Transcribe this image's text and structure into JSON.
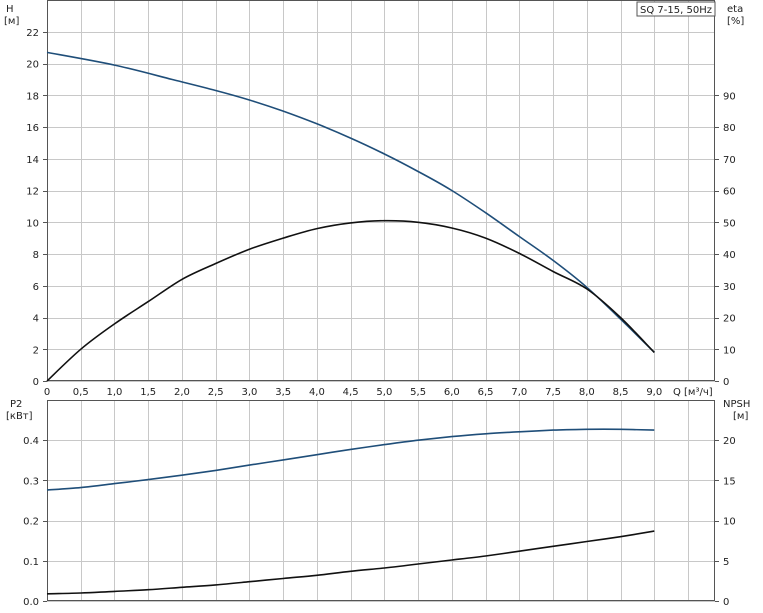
{
  "chart_data": [
    {
      "type": "line",
      "legend_box": "SQ 7-15, 50Hz",
      "grid": true,
      "x_axis": {
        "label": "Q",
        "unit": "[м³/ч]",
        "range": [
          0,
          9.9
        ],
        "ticks": [
          "0",
          "0,5",
          "1,0",
          "1,5",
          "2,0",
          "2,5",
          "3,0",
          "3,5",
          "4,0",
          "4,5",
          "5,0",
          "5,5",
          "6,0",
          "6,5",
          "7,0",
          "7,5",
          "8,0",
          "8,5",
          "9,0"
        ]
      },
      "left_axis": {
        "label": "H",
        "unit": "[м]",
        "range": [
          0,
          24
        ],
        "ticks": [
          "0",
          "2",
          "4",
          "6",
          "8",
          "10",
          "12",
          "14",
          "16",
          "18",
          "20",
          "22"
        ]
      },
      "right_axis": {
        "label": "eta",
        "unit": "[%]",
        "range": [
          0,
          120
        ],
        "ticks": [
          "0",
          "10",
          "20",
          "30",
          "40",
          "50",
          "60",
          "70",
          "80",
          "90"
        ]
      },
      "series": [
        {
          "axis": "left",
          "color": "#1f4e79",
          "x": [
            0,
            1.0,
            1.85,
            2.5,
            3.0,
            3.5,
            4.0,
            4.5,
            5.0,
            5.5,
            6.0,
            6.5,
            7.0,
            7.5,
            8.0,
            8.5,
            9.0
          ],
          "y": [
            20.7,
            19.9,
            19.0,
            18.3,
            17.7,
            17.0,
            16.2,
            15.3,
            14.3,
            13.2,
            12.0,
            10.6,
            9.1,
            7.6,
            5.9,
            3.9,
            1.8
          ]
        },
        {
          "axis": "right",
          "color": "#111111",
          "x": [
            0,
            0.5,
            1.0,
            1.5,
            2.0,
            2.5,
            3.0,
            3.5,
            4.0,
            4.5,
            5.0,
            5.5,
            6.0,
            6.5,
            7.0,
            7.5,
            8.0,
            8.5,
            9.0
          ],
          "y": [
            0,
            10.0,
            18.0,
            25.0,
            32.0,
            37.0,
            41.5,
            45.0,
            48.0,
            49.8,
            50.5,
            50.0,
            48.2,
            45.0,
            40.2,
            34.5,
            29.0,
            20.0,
            9.0
          ]
        }
      ]
    },
    {
      "type": "line",
      "grid": true,
      "x_axis": {
        "range": [
          0,
          9.9
        ]
      },
      "left_axis": {
        "label": "P2",
        "unit": "[кВт]",
        "range": [
          0,
          0.5
        ],
        "ticks": [
          "0.0",
          "0.1",
          "0.2",
          "0.3",
          "0.4"
        ]
      },
      "right_axis": {
        "label": "NPSH",
        "unit": "[м]",
        "range": [
          0,
          25
        ],
        "ticks": [
          "0",
          "5",
          "10",
          "15",
          "20"
        ]
      },
      "series": [
        {
          "axis": "left",
          "color": "#1f4e79",
          "x": [
            0,
            0.5,
            1.0,
            1.5,
            2.0,
            2.5,
            3.0,
            3.5,
            4.0,
            4.5,
            5.0,
            5.5,
            6.0,
            6.5,
            7.0,
            7.5,
            8.0,
            8.5,
            9.0
          ],
          "y": [
            0.276,
            0.282,
            0.292,
            0.302,
            0.313,
            0.325,
            0.338,
            0.351,
            0.364,
            0.377,
            0.389,
            0.4,
            0.409,
            0.416,
            0.421,
            0.425,
            0.427,
            0.427,
            0.425
          ]
        },
        {
          "axis": "right",
          "color": "#111111",
          "x": [
            0,
            0.5,
            1.0,
            1.5,
            2.0,
            2.5,
            3.0,
            3.5,
            4.0,
            4.5,
            5.0,
            5.5,
            6.0,
            6.5,
            7.0,
            7.5,
            8.0,
            8.5,
            9.0
          ],
          "y": [
            0.9,
            1.0,
            1.2,
            1.4,
            1.7,
            2.0,
            2.4,
            2.8,
            3.2,
            3.7,
            4.1,
            4.6,
            5.1,
            5.6,
            6.2,
            6.8,
            7.4,
            8.0,
            8.7
          ]
        }
      ]
    }
  ]
}
